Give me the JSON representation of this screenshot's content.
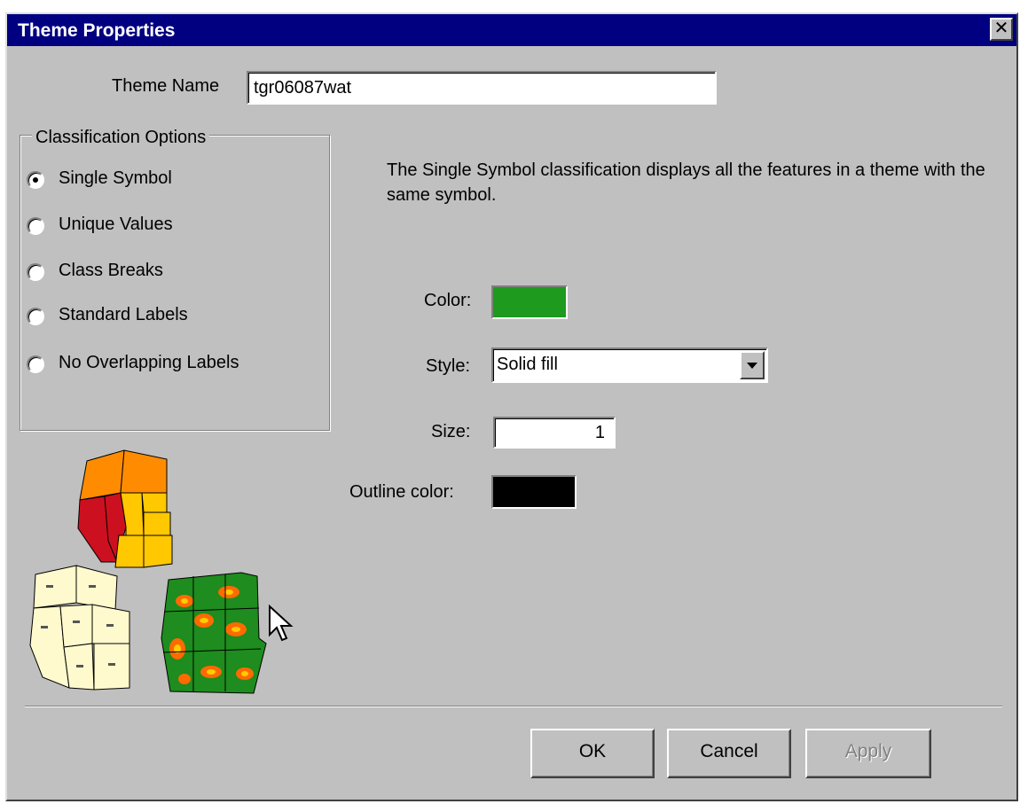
{
  "window": {
    "title": "Theme Properties",
    "close_glyph": "✕"
  },
  "theme_name": {
    "label": "Theme Name",
    "value": "tgr06087wat"
  },
  "classification": {
    "group_label": "Classification Options",
    "options": [
      {
        "label": "Single Symbol",
        "checked": true
      },
      {
        "label": "Unique Values",
        "checked": false
      },
      {
        "label": "Class Breaks",
        "checked": false
      },
      {
        "label": "Standard Labels",
        "checked": false
      },
      {
        "label": "No Overlapping Labels",
        "checked": false
      }
    ]
  },
  "description": "The Single Symbol classification displays all the features in a theme with the same symbol.",
  "symbol": {
    "color_label": "Color:",
    "color_value": "#1e9a1e",
    "style_label": "Style:",
    "style_value": "Solid fill",
    "size_label": "Size:",
    "size_value": "1",
    "outline_label": "Outline color:",
    "outline_value": "#000000"
  },
  "buttons": {
    "ok": "OK",
    "cancel": "Cancel",
    "apply": "Apply"
  },
  "icons": [
    "close-icon",
    "dropdown-arrow-icon",
    "mouse-pointer-icon",
    "map-illustration"
  ]
}
